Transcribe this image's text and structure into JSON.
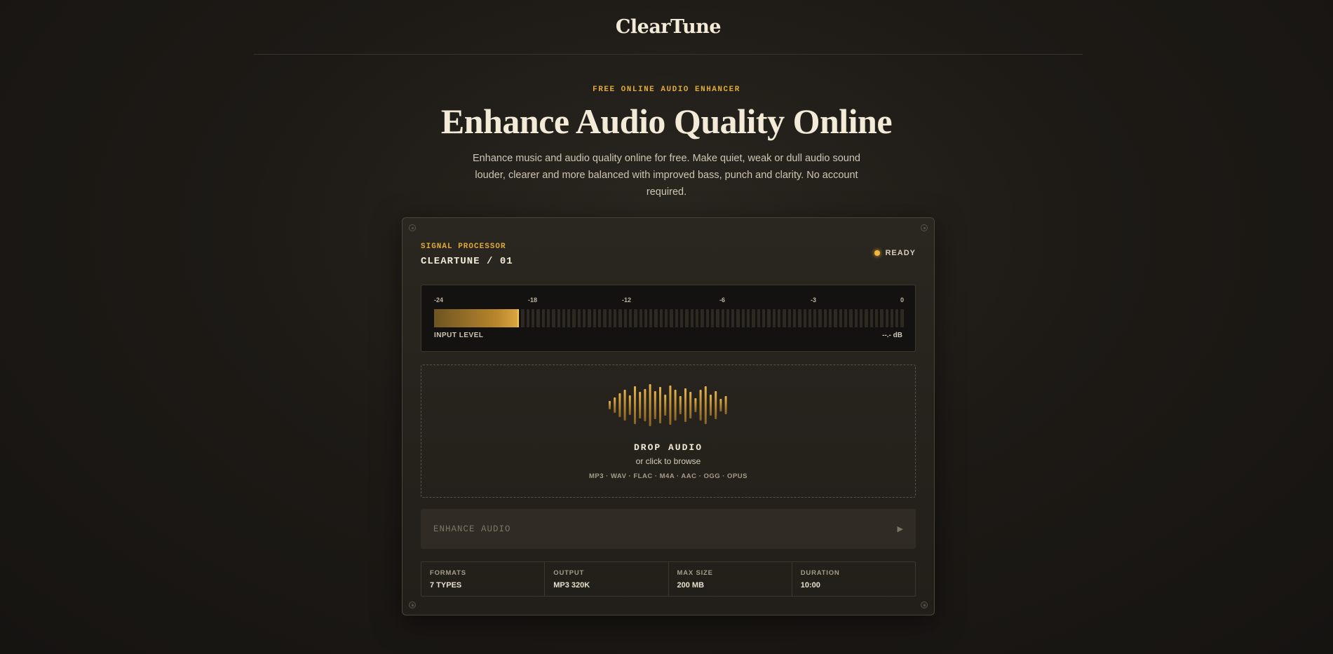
{
  "header": {
    "logo": "ClearTune"
  },
  "hero": {
    "eyebrow": "FREE ONLINE AUDIO ENHANCER",
    "title": "Enhance Audio Quality Online",
    "subtitle": "Enhance music and audio quality online for free. Make quiet, weak or dull audio sound louder, clearer and more balanced with improved bass, punch and clarity. No account required."
  },
  "panel": {
    "label": "SIGNAL PROCESSOR",
    "model": "CLEARTUNE / 01",
    "status": "READY",
    "meter": {
      "ticks": [
        "-24",
        "-18",
        "-12",
        "-6",
        "-3",
        "0"
      ],
      "label": "INPUT LEVEL",
      "value": "--.- dB",
      "level_fraction": 0.18
    },
    "dropzone": {
      "title": "DROP AUDIO",
      "subtitle": "or click to browse",
      "formats": "MP3 · WAV · FLAC · M4A · AAC · OGG · OPUS"
    },
    "enhance_button": {
      "label": "ENHANCE AUDIO",
      "icon": "play-icon"
    },
    "specs": [
      {
        "key": "FORMATS",
        "value": "7 TYPES"
      },
      {
        "key": "OUTPUT",
        "value": "MP3 320K"
      },
      {
        "key": "MAX SIZE",
        "value": "200 MB"
      },
      {
        "key": "DURATION",
        "value": "10:00"
      }
    ]
  },
  "colors": {
    "accent": "#e0a93b",
    "background": "#1d1a16",
    "text": "#f3ead8"
  }
}
